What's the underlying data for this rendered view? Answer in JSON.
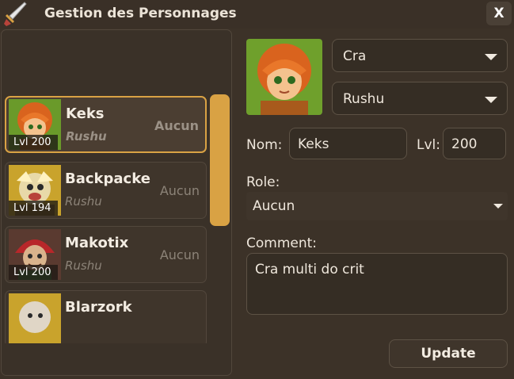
{
  "window": {
    "title": "Gestion des Personnages",
    "close_label": "X",
    "app_icon": "sword-icon"
  },
  "characters": [
    {
      "name": "Keks",
      "server": "Rushu",
      "role": "Aucun",
      "level": "Lvl 200",
      "selected": true
    },
    {
      "name": "Backpacke",
      "server": "Rushu",
      "role": "Aucun",
      "level": "Lvl 194",
      "selected": false
    },
    {
      "name": "Makotix",
      "server": "Rushu",
      "role": "Aucun",
      "level": "Lvl 200",
      "selected": false
    },
    {
      "name": "Blarzork",
      "server": "",
      "role": "",
      "level": "",
      "selected": false
    }
  ],
  "details": {
    "class_value": "Cra",
    "server_value": "Rushu",
    "name_label": "Nom:",
    "name_value": "Keks",
    "level_label": "Lvl:",
    "level_value": "200",
    "role_label": "Role:",
    "role_value": "Aucun",
    "comment_label": "Comment:",
    "comment_value": "Cra multi do crit",
    "update_label": "Update"
  },
  "colors": {
    "accent": "#d9a244",
    "background": "#3c3228"
  }
}
